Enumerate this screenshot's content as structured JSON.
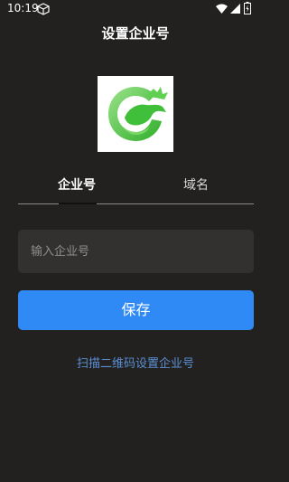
{
  "status_bar": {
    "time": "10:19",
    "icons": [
      "cube-icon",
      "wifi-icon",
      "signal-icon",
      "battery-icon"
    ]
  },
  "header": {
    "title": "设置企业号"
  },
  "logo": {
    "icon": "dragon-logo-icon",
    "color": "#3fbf3a"
  },
  "tabs": [
    {
      "label": "企业号",
      "active": true
    },
    {
      "label": "域名",
      "active": false
    }
  ],
  "form": {
    "company_placeholder": "输入企业号",
    "company_value": "",
    "save_label": "保存",
    "scan_link_label": "扫描二维码设置企业号"
  },
  "colors": {
    "background": "#222120",
    "accent": "#2f8af5",
    "link": "#5b8fd2",
    "input_bg": "#323130"
  }
}
